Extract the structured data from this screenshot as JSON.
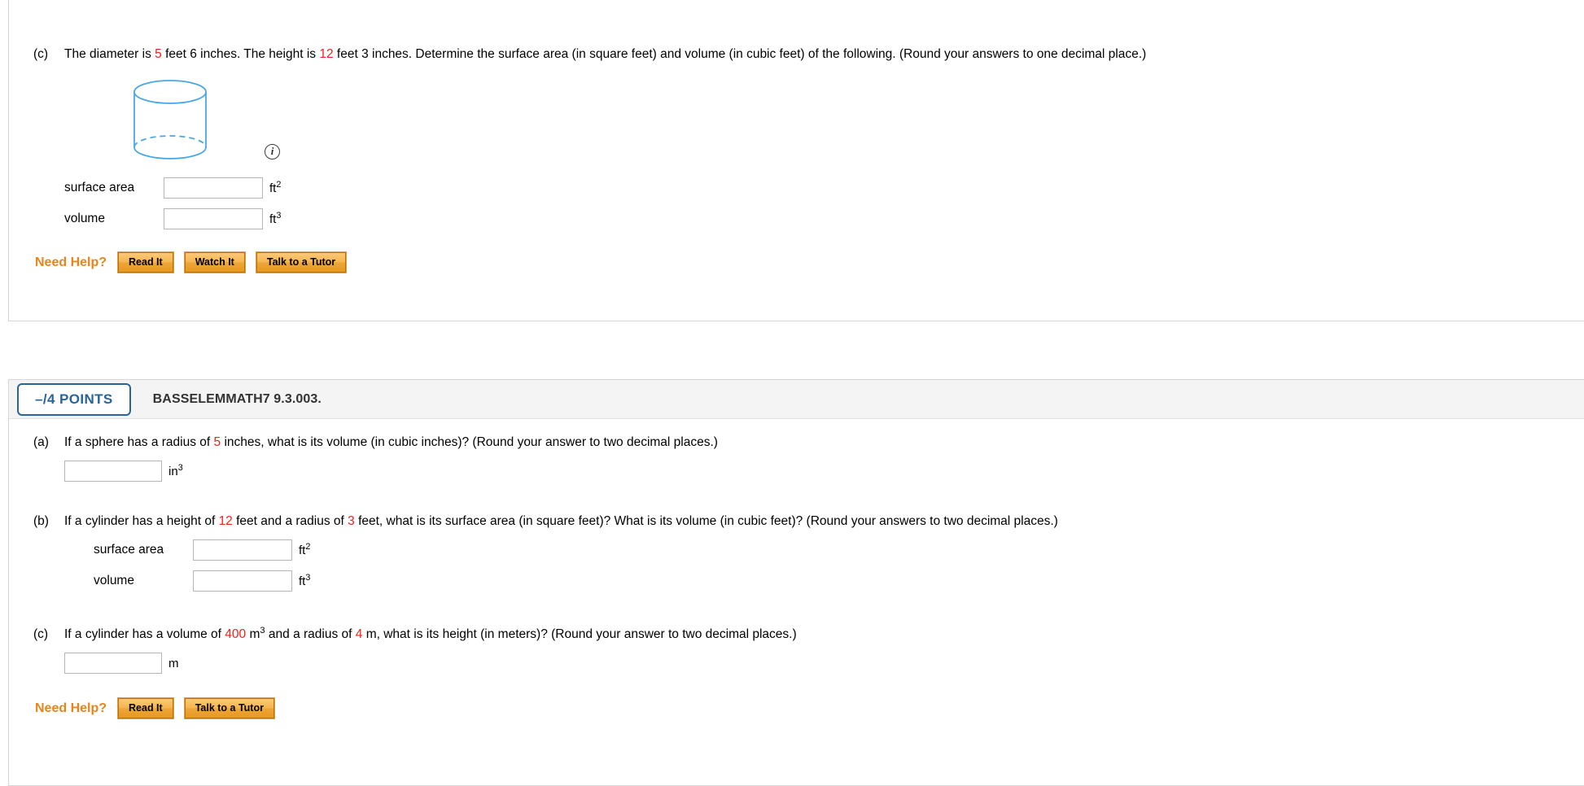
{
  "question_one": {
    "part_c": {
      "letter": "(c)",
      "text_before_d": "The diameter is ",
      "diameter": "5",
      "text_mid": " feet 6 inches. The height is ",
      "height": "12",
      "text_after": " feet 3 inches. Determine the surface area (in square feet) and volume (in cubic feet) of the following. (Round your answers to one decimal place.)"
    },
    "figure": {
      "shape": "cylinder",
      "info_glyph": "i",
      "outline_color": "#4aa7e0"
    },
    "answers": [
      {
        "label": "surface area",
        "value": "",
        "unit": "ft",
        "exponent": "2"
      },
      {
        "label": "volume",
        "value": "",
        "unit": "ft",
        "exponent": "3"
      }
    ],
    "need_help": {
      "label": "Need Help?",
      "buttons": [
        "Read It",
        "Watch It",
        "Talk to a Tutor"
      ]
    }
  },
  "question_two": {
    "points_badge": "–/4 POINTS",
    "points_label": "BASSELEMMATH7 9.3.003.",
    "part_a": {
      "letter": "(a)",
      "text_1": "If a sphere has a radius of ",
      "radius": "5",
      "text_2": " inches, what is its volume (in cubic inches)? (Round your answer to two decimal places.)",
      "answer": {
        "value": "",
        "unit": "in",
        "exponent": "3"
      }
    },
    "part_b": {
      "letter": "(b)",
      "text_1": "If a cylinder has a height of ",
      "height": "12",
      "text_2": " feet and a radius of ",
      "radius": "3",
      "text_3": " feet, what is its surface area (in square feet)? What is its volume (in cubic feet)? (Round your answers to two decimal places.)",
      "answers": [
        {
          "label": "surface area",
          "value": "",
          "unit": "ft",
          "exponent": "2"
        },
        {
          "label": "volume",
          "value": "",
          "unit": "ft",
          "exponent": "3"
        }
      ]
    },
    "part_c": {
      "letter": "(c)",
      "text_1": "If a cylinder has a volume of ",
      "volume": "400",
      "unit_1": " m",
      "unit_1_exp": "3",
      "text_2": " and a radius of ",
      "radius": "4",
      "text_3": " m, what is its height (in meters)? (Round your answer to two decimal places.)",
      "answer": {
        "value": "",
        "unit": "m",
        "exponent": ""
      }
    },
    "need_help": {
      "label": "Need Help?",
      "buttons": [
        "Read It",
        "Talk to a Tutor"
      ]
    }
  },
  "colors": {
    "accent_orange": "#e8841a",
    "badge_blue": "#2a6496",
    "highlight_red": "#ee2222",
    "figure_blue": "#4aa7e0"
  }
}
